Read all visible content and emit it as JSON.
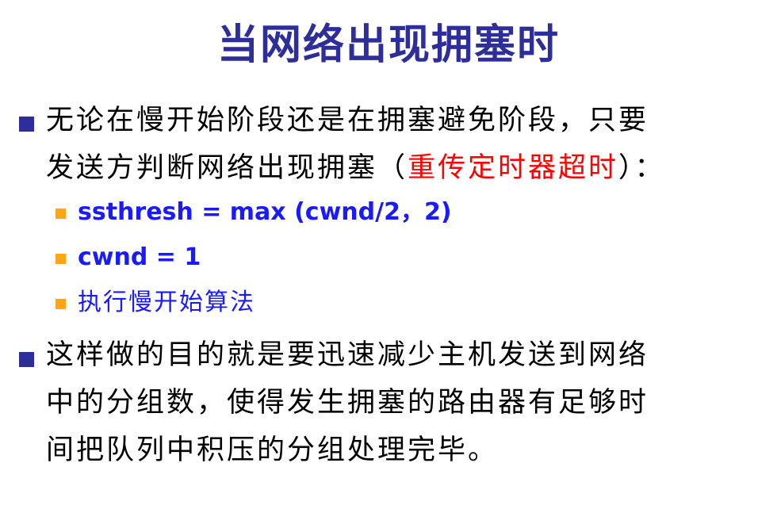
{
  "title": "当网络出现拥塞时",
  "bullets": [
    {
      "line1": "无论在慢开始阶段还是在拥塞避免阶段，只要",
      "line2_prefix": "发送方判断网络出现拥塞（",
      "line2_highlight": "重传定时器超时",
      "line2_suffix": "）：",
      "highlight_color": "#ff0000"
    },
    {
      "line1": "这样做的目的就是要迅速减少主机发送到网络",
      "line2": "中的分组数，使得发生拥塞的路由器有足够时",
      "line3": "间把队列中积压的分组处理完毕。"
    }
  ],
  "sub_items": [
    "ssthresh = max (cwnd/2，2)",
    "cwnd = 1",
    "执行慢开始算法"
  ],
  "colors": {
    "title": "#2e2e9a",
    "bullet_marker": "#2e2e9a",
    "sub_marker": "#ffa51a",
    "sub_text": "#1a1aff",
    "highlight": "#ff0000"
  }
}
